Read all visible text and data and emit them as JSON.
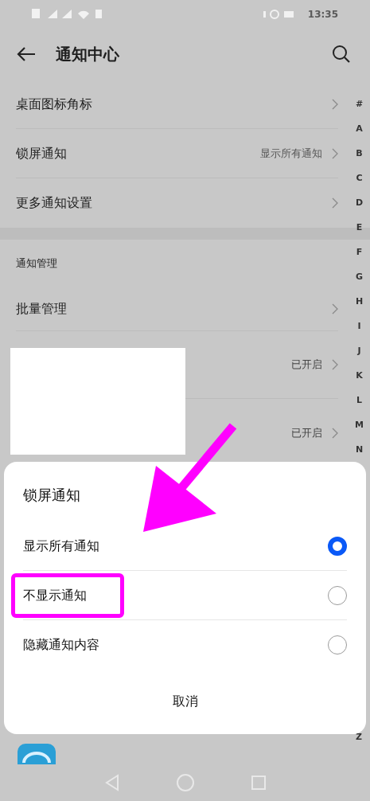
{
  "status_bar": {
    "time": "13:35"
  },
  "header": {
    "title": "通知中心"
  },
  "settings": [
    {
      "label": "桌面图标角标"
    },
    {
      "label": "锁屏通知",
      "value": "显示所有通知"
    },
    {
      "label": "更多通知设置"
    }
  ],
  "section": {
    "title": "通知管理"
  },
  "batch": {
    "label": "批量管理"
  },
  "apps": [
    {
      "status": "已开启"
    },
    {
      "status": "已开启"
    }
  ],
  "index_letters": [
    "#",
    "A",
    "B",
    "C",
    "D",
    "E",
    "F",
    "G",
    "H",
    "I",
    "J",
    "K",
    "L",
    "M",
    "N"
  ],
  "index_last": "Z",
  "sheet": {
    "title": "锁屏通知",
    "options": [
      {
        "label": "显示所有通知",
        "selected": true
      },
      {
        "label": "不显示通知",
        "selected": false
      },
      {
        "label": "隐藏通知内容",
        "selected": false
      }
    ],
    "cancel": "取消"
  }
}
